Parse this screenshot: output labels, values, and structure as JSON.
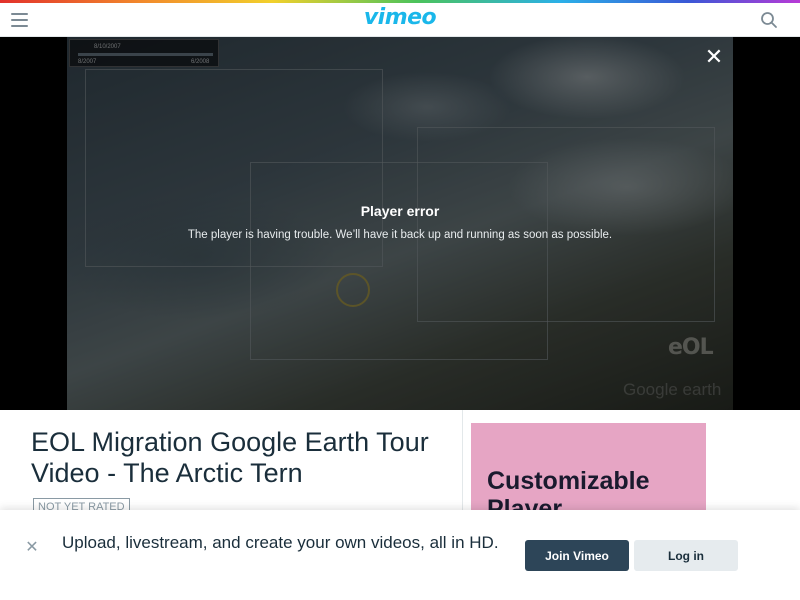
{
  "header": {
    "logo": "vimeo",
    "menu_icon": "hamburger-menu-icon",
    "search_icon": "search-icon"
  },
  "player": {
    "error_title": "Player error",
    "error_message": "The player is having trouble. We’ll have it back up and running as soon as possible.",
    "close_icon": "close-icon",
    "overlay_watermark": "eOL",
    "earth_watermark": "Google earth",
    "timeline": {
      "current": "8/10/2007",
      "start": "8/2007",
      "end": "6/2008"
    }
  },
  "video": {
    "title": "EOL Migration Google Earth Tour Video - The Arctic Tern",
    "rating_badge": "NOT YET RATED"
  },
  "ad": {
    "text": "Customizable Player"
  },
  "banner": {
    "message": "Upload, livestream, and create your own videos, all in HD.",
    "join_label": "Join Vimeo",
    "login_label": "Log in",
    "dismiss_icon": "close-icon"
  },
  "colors": {
    "brand": "#1ab7ea",
    "primary_button": "#2d4558",
    "ad_background": "#e6a5c4"
  }
}
